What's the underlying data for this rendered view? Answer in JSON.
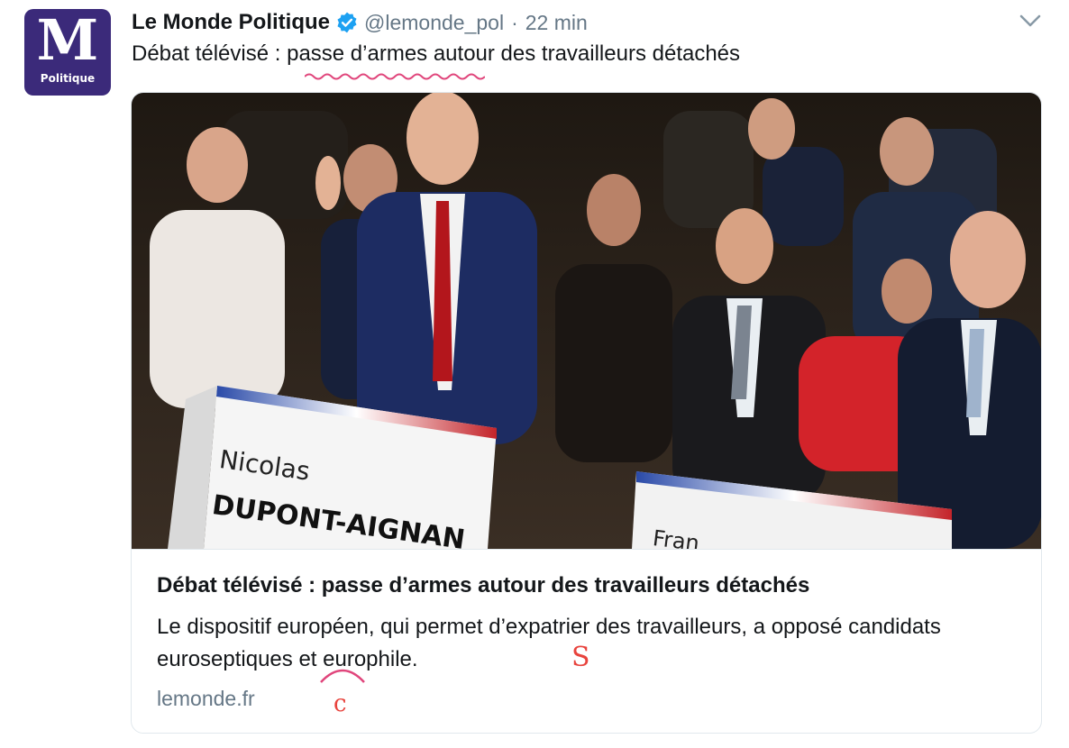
{
  "avatar": {
    "letter": "M",
    "label": "Politique"
  },
  "author": {
    "name": "Le Monde Politique",
    "handle": "@lemonde_pol",
    "separator": "·",
    "time": "22 min"
  },
  "tweet": {
    "text": "Débat télévisé : passe d’armes autour des travailleurs détachés"
  },
  "card": {
    "image_text": {
      "first_name": "Nicolas",
      "last_name": "DUPONT-AIGNAN",
      "partial": "Fran"
    },
    "title": "Débat télévisé : passe d’armes autour des travailleurs détachés",
    "description": "Le dispositif européen, qui permet d’expatrier des travailleurs, a opposé candidats euroseptiques et europhile.",
    "domain": "lemonde.fr"
  },
  "annotations": {
    "s_letter": "S",
    "c_letter": "c"
  },
  "colors": {
    "accent": "#1da1f2",
    "avatar_bg": "#3b2a7a",
    "annotation": "#e8433d",
    "muted": "#657786"
  }
}
